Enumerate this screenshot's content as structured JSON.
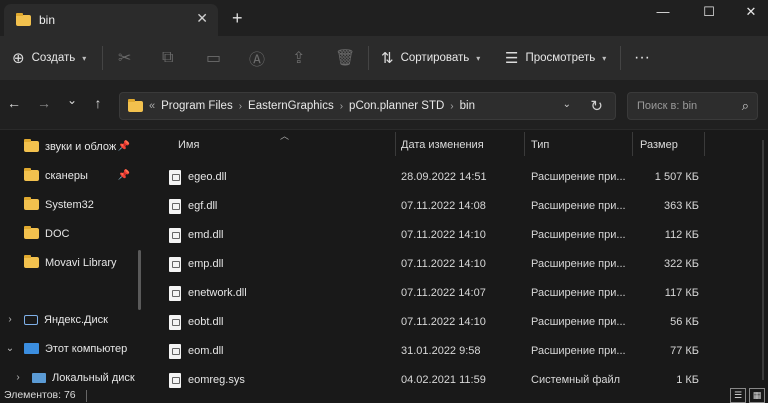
{
  "tab": {
    "title": "bin",
    "close": "✕",
    "new": "+"
  },
  "window": {
    "minimize": "—",
    "maximize": "☐",
    "close": "✕"
  },
  "toolbar": {
    "create": {
      "label": "Создать",
      "icon": "plus-circle-icon"
    },
    "sort": {
      "label": "Сортировать"
    },
    "view": {
      "label": "Просмотреть"
    },
    "more": "···"
  },
  "nav": {
    "back": "←",
    "forward": "→",
    "recent": "⌄",
    "up": "↑"
  },
  "address": {
    "overflow": "«",
    "segments": [
      "Program Files",
      "EasternGraphics",
      "pCon.planner STD",
      "bin"
    ],
    "separator": "›"
  },
  "search": {
    "placeholder": "Поиск в: bin"
  },
  "sidebar": {
    "items": [
      {
        "label": "звуки и облож",
        "pinned": true
      },
      {
        "label": "сканеры",
        "pinned": true
      },
      {
        "label": "System32",
        "pinned": false
      },
      {
        "label": "DOC",
        "pinned": false
      },
      {
        "label": "Movavi Library",
        "pinned": false
      },
      {
        "label": "Яндекс.Диск",
        "pinned": false
      },
      {
        "label": "Этот компьютер",
        "pinned": false
      },
      {
        "label": "Локальный диск",
        "pinned": false
      }
    ],
    "pin_glyph": "📌"
  },
  "columns": {
    "name": "Имя",
    "date": "Дата изменения",
    "type": "Тип",
    "size": "Размер"
  },
  "files": [
    {
      "name": "egeo.dll",
      "date": "28.09.2022 14:51",
      "type": "Расширение при...",
      "size": "1 507 КБ"
    },
    {
      "name": "egf.dll",
      "date": "07.11.2022 14:08",
      "type": "Расширение при...",
      "size": "363 КБ"
    },
    {
      "name": "emd.dll",
      "date": "07.11.2022 14:10",
      "type": "Расширение при...",
      "size": "112 КБ"
    },
    {
      "name": "emp.dll",
      "date": "07.11.2022 14:10",
      "type": "Расширение при...",
      "size": "322 КБ"
    },
    {
      "name": "enetwork.dll",
      "date": "07.11.2022 14:07",
      "type": "Расширение при...",
      "size": "117 КБ"
    },
    {
      "name": "eobt.dll",
      "date": "07.11.2022 14:10",
      "type": "Расширение при...",
      "size": "56 КБ"
    },
    {
      "name": "eom.dll",
      "date": "31.01.2022 9:58",
      "type": "Расширение при...",
      "size": "77 КБ"
    },
    {
      "name": "eomreg.sys",
      "date": "04.02.2021 11:59",
      "type": "Системный файл",
      "size": "1 КБ"
    }
  ],
  "status": {
    "count": "Элементов: 76"
  },
  "colors": {
    "accent": "#f2c14e",
    "background": "#191919",
    "toolbar": "#2b2b2b"
  }
}
